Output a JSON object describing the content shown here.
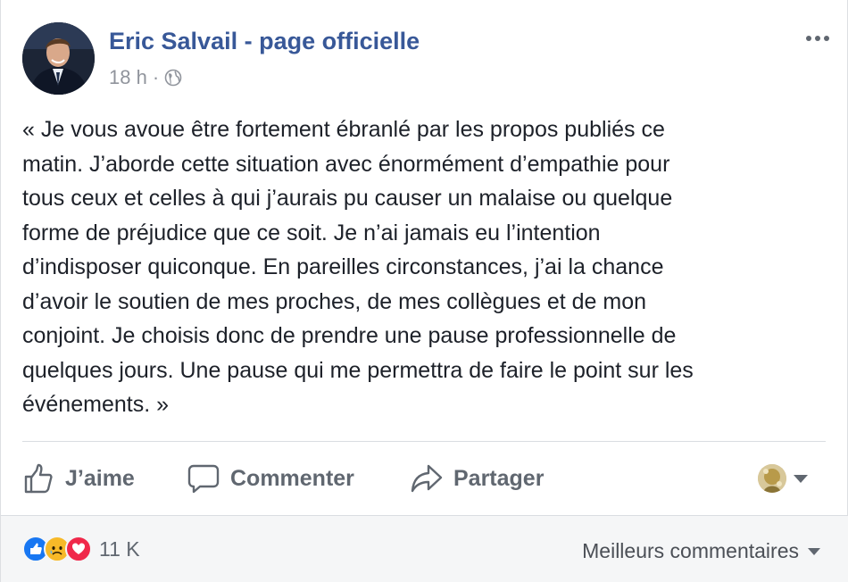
{
  "post": {
    "page_name": "Eric Salvail - page officielle",
    "timestamp": "18 h",
    "separator": "·",
    "audience_icon": "globe-icon",
    "text": "« Je vous avoue être fortement ébranlé par les propos publiés ce\nmatin. J’aborde cette situation avec énormément d’empathie pour\ntous ceux et celles à qui j’aurais pu causer un malaise ou quelque\nforme de préjudice que ce soit. Je n’ai jamais eu l’intention\nd’indisposer quiconque. En pareilles circonstances, j’ai la chance\nd’avoir le soutien de mes proches, de mes collègues et de mon\nconjoint. Je choisis donc de prendre une pause professionnelle de\nquelques jours. Une pause qui me permettra de faire le point sur les\névénements. »"
  },
  "actions": {
    "like_label": "J’aime",
    "comment_label": "Commenter",
    "share_label": "Partager"
  },
  "footer": {
    "reaction_icons": [
      "like-reaction-icon",
      "sad-reaction-icon",
      "love-reaction-icon"
    ],
    "reaction_count": "11 K",
    "sort_label": "Meilleurs commentaires"
  },
  "colors": {
    "link_blue": "#385898",
    "meta_gray": "#90949c",
    "action_gray": "#606770",
    "like_blue": "#1877f2",
    "love_red": "#f0284a",
    "sad_yellow": "#f7b928"
  }
}
